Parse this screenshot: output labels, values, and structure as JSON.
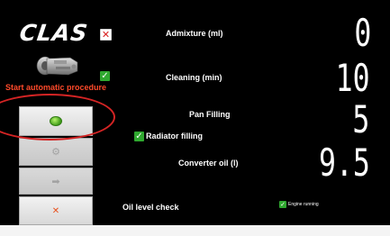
{
  "brand": {
    "logo_text": "CLAS"
  },
  "accent_colors": {
    "orange_text": "#ff4a2a",
    "highlight_circle": "#d42424",
    "checkbox_green": "#2fa82f",
    "checkbox_red_cross": "#d81e1e"
  },
  "left_panel": {
    "image_icon": "gearbox-icon",
    "start_auto_label": "Start automatic procedure",
    "buttons": [
      {
        "icon": "go-green-icon",
        "state": "enabled"
      },
      {
        "icon": "gear-icon",
        "state": "disabled"
      },
      {
        "icon": "pump-icon",
        "state": "disabled"
      },
      {
        "icon": "close-x-icon",
        "state": "enabled"
      }
    ]
  },
  "rows": {
    "admixture": {
      "label": "Admixture (ml)",
      "value": "0",
      "checkbox": "unchecked-cross"
    },
    "cleaning": {
      "label": "Cleaning (min)",
      "value": "10",
      "checkbox": "checked"
    },
    "pan_filling": {
      "label": "Pan Filling",
      "value": "5"
    },
    "radiator": {
      "label": "Radiator filling",
      "checkbox": "checked"
    },
    "converter": {
      "label": "Converter oil (l)",
      "value": "9.5"
    },
    "oil_level": {
      "label": "Oil level check"
    },
    "engine_running": {
      "label": "Engine running",
      "checkbox": "checked"
    }
  }
}
